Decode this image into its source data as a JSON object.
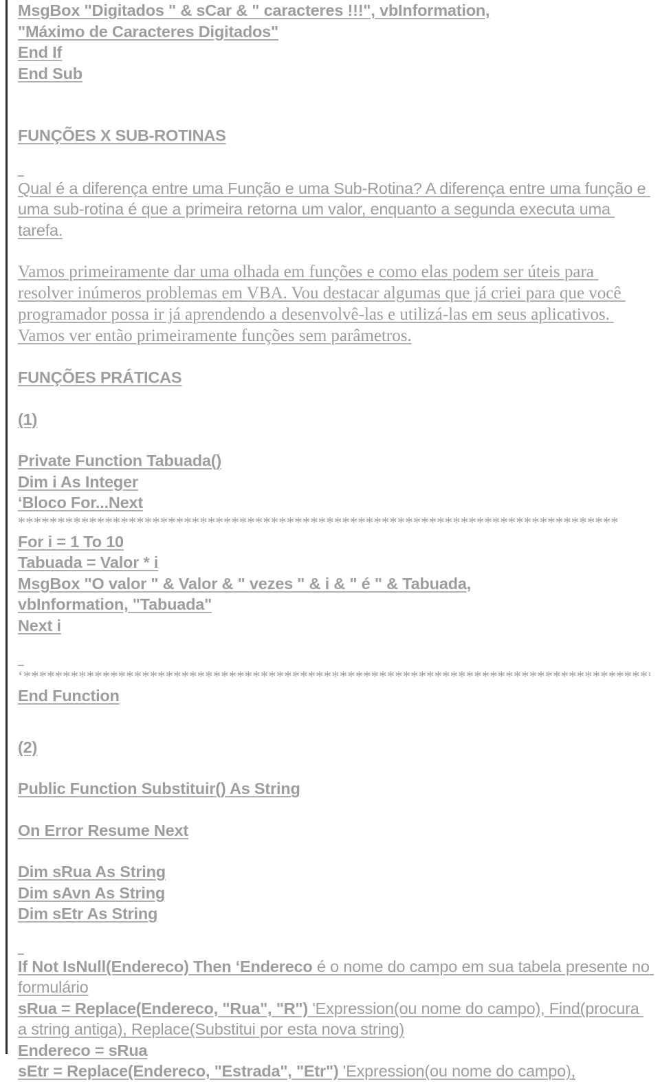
{
  "document": {
    "language": "pt-BR",
    "text_color": "#9d9d9d",
    "underline_color": "#b0b0b0",
    "rule_color": "#2b2b2b",
    "background": "#ffffff"
  },
  "code_top": {
    "line1": "MsgBox \"Digitados \" & sCar & \" caracteres !!!\", vbInformation,",
    "line2": "\"Máximo de Caracteres Digitados\"",
    "line3": "End If",
    "line4": "End Sub"
  },
  "section_funcoes_x_subrotinas": {
    "heading": "FUNÇÕES X SUB-ROTINAS",
    "paragraph": "Qual é a diferença entre uma Função e uma Sub-Rotina? A diferença entre uma função e uma sub-rotina é que a primeira retorna um valor, enquanto a segunda executa uma tarefa."
  },
  "serif_paragraph": {
    "text": "Vamos primeiramente dar uma olhada em funções e como elas podem ser úteis para resolver inúmeros problemas em VBA. Vou destacar algumas que já criei para que você programador possa ir já aprendendo a desenvolvê-las e utilizá-las em seus aplicativos. Vamos ver então primeiramente funções sem parâmetros."
  },
  "section_funcoes_praticas": {
    "heading": "FUNÇÕES PRÁTICAS"
  },
  "example_1": {
    "number": "(1)",
    "lines": [
      "Private Function Tabuada()",
      "Dim i As Integer",
      "‘Bloco For...Next"
    ],
    "separator_top": "****************************************************************************",
    "body": [
      "For i = 1 To 10",
      "Tabuada = Valor * i",
      "MsgBox \"O valor \" & Valor & \" vezes \" & i & \" é \" & Tabuada,",
      "vbInformation, \"Tabuada\"",
      "Next i"
    ],
    "separator_bottom": "‘***********************************************************************************",
    "end": "End Function"
  },
  "example_2": {
    "number": "(2)",
    "signature": "Public Function Substituir() As String",
    "on_error": "On Error Resume Next",
    "declarations": [
      "Dim sRua As String",
      "Dim sAvn As String",
      "Dim sEtr As String"
    ],
    "mixed_lines": [
      {
        "code": "If Not IsNull(Endereco) Then ‘Endereco",
        "comment": " é o nome do campo em sua tabela presente no formulário"
      },
      {
        "code": "sRua = Replace(Endereco, \"Rua\", \"R\")",
        "comment": " 'Expression(ou nome do campo), Find(procura a string antiga), Replace(Substitui por esta nova string)"
      },
      {
        "code": "Endereco = sRua",
        "comment": ""
      },
      {
        "code": "sEtr = Replace(Endereco, \"Estrada\", \"Etr\")",
        "comment": " 'Expression(ou nome do campo),"
      }
    ]
  }
}
